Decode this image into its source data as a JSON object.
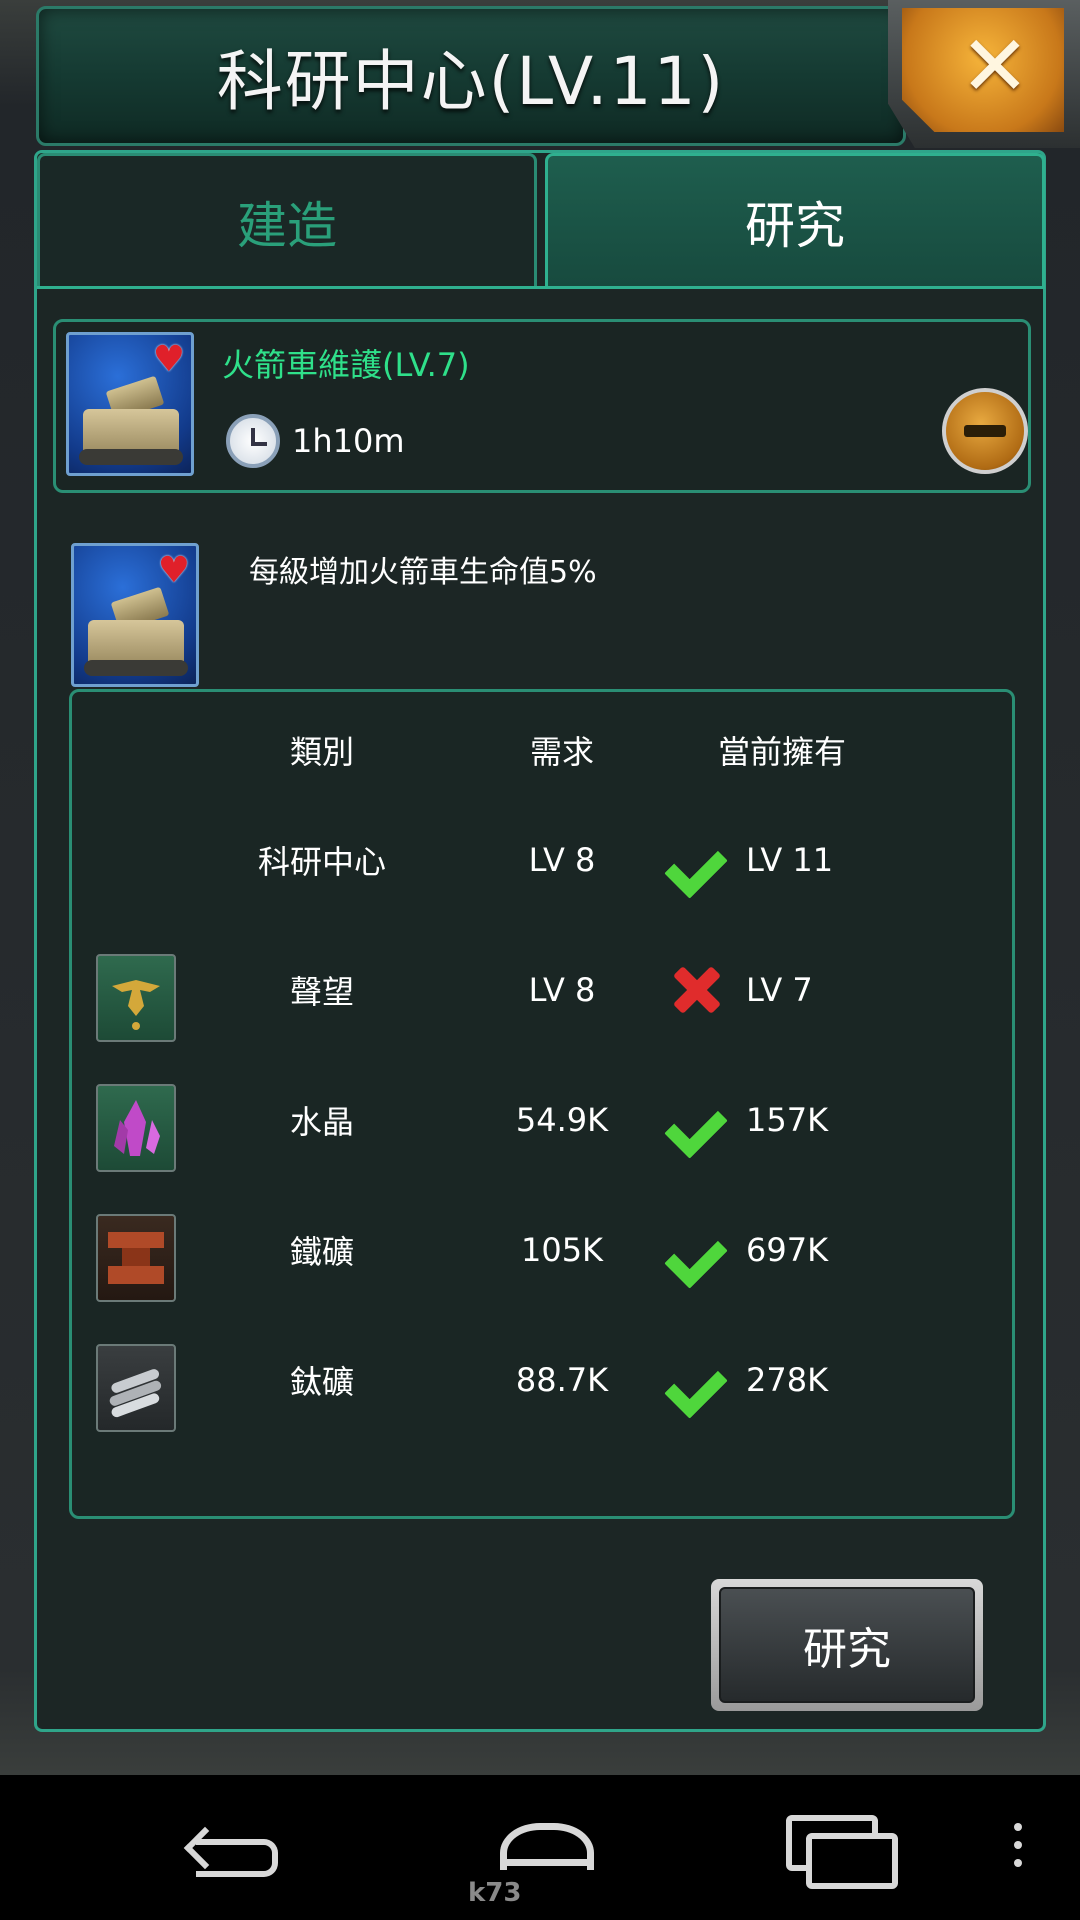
{
  "title": "科研中心(LV.11)",
  "tabs": [
    {
      "label": "建造",
      "active": false
    },
    {
      "label": "研究",
      "active": true
    }
  ],
  "current_research": {
    "name": "火箭車維護(LV.7)",
    "time": "1h10m"
  },
  "description": "每級增加火箭車生命值5%",
  "requirements": {
    "headers": {
      "category": "類別",
      "need": "需求",
      "have": "當前擁有"
    },
    "rows": [
      {
        "category": "科研中心",
        "need": "LV 8",
        "have": "LV 11",
        "ok": true,
        "icon": null
      },
      {
        "category": "聲望",
        "need": "LV 8",
        "have": "LV 7",
        "ok": false,
        "icon": "eagle-emblem-icon"
      },
      {
        "category": "水晶",
        "need": "54.9K",
        "have": "157K",
        "ok": true,
        "icon": "crystal-icon"
      },
      {
        "category": "鐵礦",
        "need": "105K",
        "have": "697K",
        "ok": true,
        "icon": "iron-ingot-icon"
      },
      {
        "category": "鈦礦",
        "need": "88.7K",
        "have": "278K",
        "ok": true,
        "icon": "titanium-rods-icon"
      }
    ]
  },
  "research_button": "研究",
  "watermark": "k73",
  "colors": {
    "accent": "#2fb08f",
    "name_green": "#2fe08a",
    "check": "#4fd63c",
    "cross": "#e02c2c",
    "close_orange": "#f6b43a"
  }
}
